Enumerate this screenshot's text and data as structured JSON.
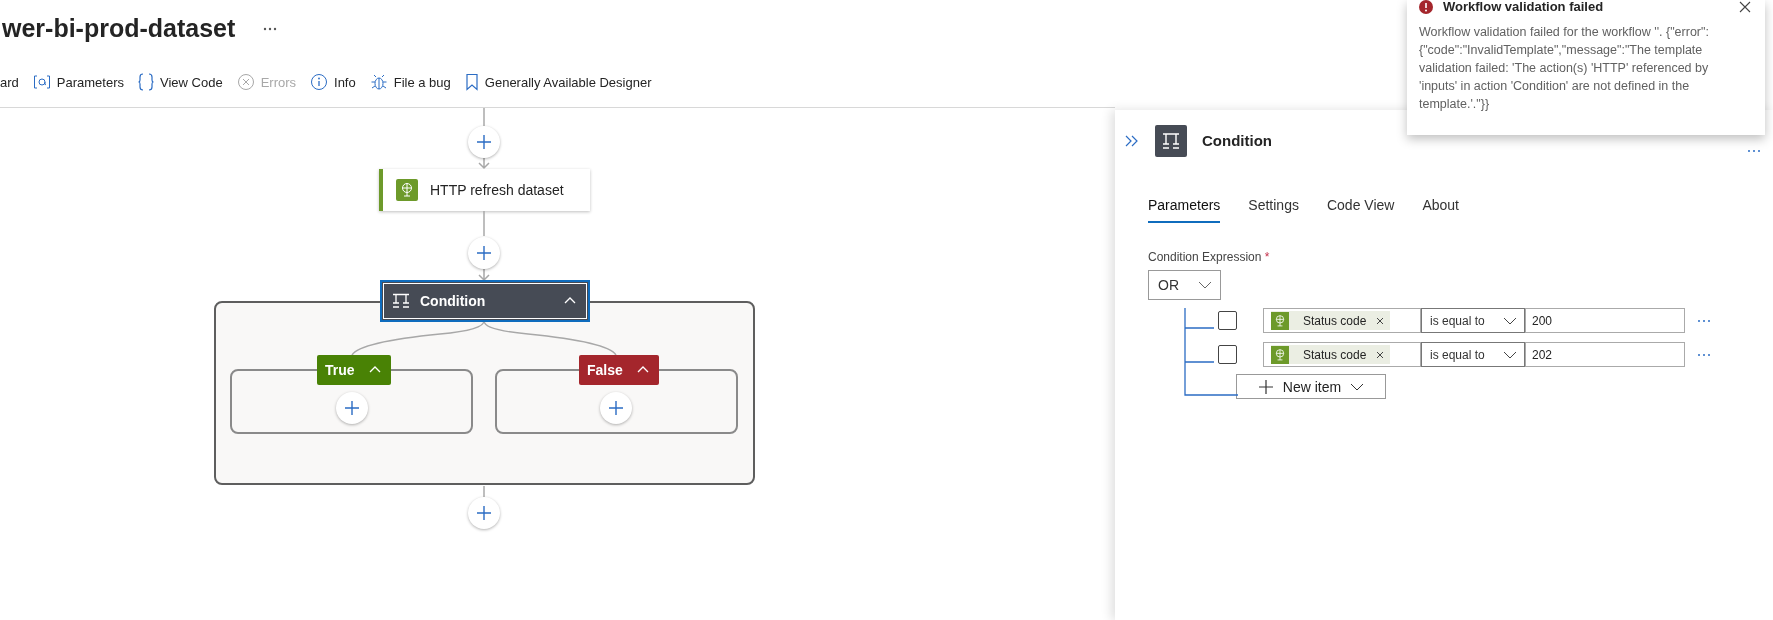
{
  "header": {
    "title": "wer-bi-prod-dataset"
  },
  "toolbar": [
    {
      "label": "ard",
      "kind": "cut",
      "disabled": false
    },
    {
      "label": "Parameters",
      "kind": "parameters",
      "disabled": false
    },
    {
      "label": "View Code",
      "kind": "code",
      "disabled": false
    },
    {
      "label": "Errors",
      "kind": "errors",
      "disabled": true
    },
    {
      "label": "Info",
      "kind": "info",
      "disabled": false
    },
    {
      "label": "File a bug",
      "kind": "bug",
      "disabled": false
    },
    {
      "label": "Generally Available Designer",
      "kind": "bookmark",
      "disabled": false
    }
  ],
  "canvas": {
    "action": {
      "title": "HTTP refresh dataset"
    },
    "condition": {
      "title": "Condition",
      "expanded": true,
      "branches": [
        {
          "label": "True",
          "kind": "true",
          "expanded": true
        },
        {
          "label": "False",
          "kind": "false",
          "expanded": true
        }
      ]
    }
  },
  "panel": {
    "title": "Condition",
    "tabs": [
      {
        "label": "Parameters",
        "selected": true
      },
      {
        "label": "Settings",
        "selected": false
      },
      {
        "label": "Code View",
        "selected": false
      },
      {
        "label": "About",
        "selected": false
      }
    ],
    "expression_label": "Condition Expression",
    "required_mark": "*",
    "group_operator": "OR",
    "rows": [
      {
        "checked": false,
        "token": "Status code",
        "operator": "is equal to",
        "value": "200"
      },
      {
        "checked": false,
        "token": "Status code",
        "operator": "is equal to",
        "value": "202"
      }
    ],
    "new_item": "New item"
  },
  "toast": {
    "title": "Workflow validation failed",
    "message": "Workflow validation failed for the workflow ''. {\"error\":{\"code\":\"InvalidTemplate\",\"message\":\"The template validation failed: 'The action(s) 'HTTP' referenced by 'inputs' in action 'Condition' are not defined in the template.'.\"}}"
  }
}
